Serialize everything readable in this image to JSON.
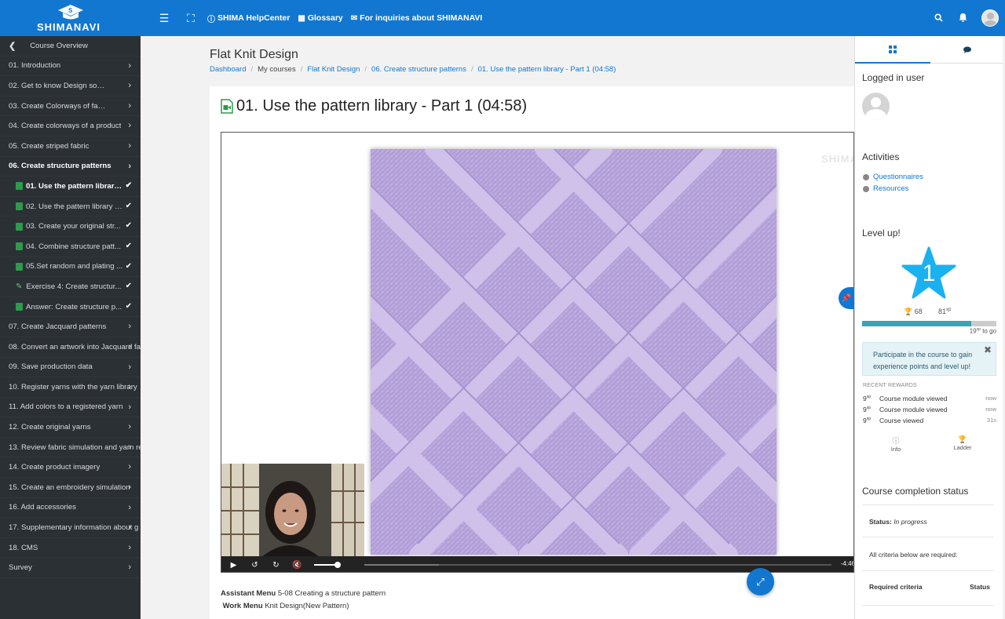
{
  "brand": {
    "name": "SHIMANAVI"
  },
  "topnav": {
    "links": [
      {
        "label": "SHIMA HelpCenter",
        "icon": "help-circle-icon"
      },
      {
        "label": "Glossary",
        "icon": "book-icon"
      },
      {
        "label": "For inquiries about SHIMANAVI",
        "icon": "envelope-icon"
      }
    ]
  },
  "drawer": {
    "back_label": "Course Overview",
    "sections": [
      {
        "label": "01. Introduction"
      },
      {
        "label": "02. Get to know Design software"
      },
      {
        "label": "03. Create Colorways of fabric"
      },
      {
        "label": "04. Create colorways of a product"
      },
      {
        "label": "05. Create striped fabric"
      },
      {
        "label": "06. Create structure patterns"
      }
    ],
    "sub_items": [
      {
        "label": "01. Use the pattern library -...",
        "type": "video"
      },
      {
        "label": "02. Use the pattern library -...",
        "type": "video"
      },
      {
        "label": "03. Create your original str...",
        "type": "video"
      },
      {
        "label": "04. Combine structure patt...",
        "type": "video"
      },
      {
        "label": "05.Set random and plating ...",
        "type": "video"
      },
      {
        "label": "Exercise 4: Create structur...",
        "type": "exercise"
      },
      {
        "label": "Answer: Create structure p...",
        "type": "video"
      }
    ],
    "sections_after": [
      {
        "label": "07. Create Jacquard patterns"
      },
      {
        "label": "08. Convert an artwork into Jacquard fa"
      },
      {
        "label": "09. Save production data"
      },
      {
        "label": "10. Register yarns with the yarn library"
      },
      {
        "label": "11. Add colors to a registered yarn"
      },
      {
        "label": "12. Create original yarns"
      },
      {
        "label": "13. Review fabric simulation and yarn re"
      },
      {
        "label": "14. Create product imagery"
      },
      {
        "label": "15. Create an embroidery simulation"
      },
      {
        "label": "16. Add accessories"
      },
      {
        "label": "17. Supplementary information about g"
      },
      {
        "label": "18. CMS"
      },
      {
        "label": "Survey"
      }
    ]
  },
  "page": {
    "title": "Flat Knit Design",
    "breadcrumb": [
      "Dashboard",
      "My courses",
      "Flat Knit Design",
      "06. Create structure patterns",
      "01. Use the pattern library - Part 1 (04:58)"
    ],
    "activity_title": "01. Use the pattern library - Part 1 (04:58)"
  },
  "player": {
    "watermark": "SHIMA",
    "time": "-4:46",
    "volume": 1.0,
    "progress": 0.0
  },
  "menu_info": {
    "assistant_label": "Assistant Menu",
    "assistant_value": "5-08 Creating a structure pattern",
    "work_label": "Work Menu",
    "work_value": "Knit Design(New Pattern)"
  },
  "right_drawer": {
    "logged_in_title": "Logged in user",
    "activities_title": "Activities",
    "activities": [
      "Questionnaires",
      "Resources"
    ],
    "level_title": "Level up!",
    "level": "1",
    "points": "68",
    "total_xp": "81",
    "xp_unit": "xp",
    "xp_to_go": "19",
    "to_go_label": "to go",
    "xp_fraction": 0.81,
    "info_message": "Participate in the course to gain experience points and level up!",
    "recent_rewards_title": "RECENT REWARDS",
    "rewards": [
      {
        "xp": "9",
        "desc": "Course module viewed",
        "when": "now"
      },
      {
        "xp": "9",
        "desc": "Course module viewed",
        "when": "now"
      },
      {
        "xp": "9",
        "desc": "Course viewed",
        "when": "31s"
      }
    ],
    "info_label": "Info",
    "ladder_label": "Ladder",
    "completion_title": "Course completion status",
    "status_label": "Status:",
    "status_value": "In progress",
    "criteria_note": "All criteria below are required:",
    "col_criteria": "Required criteria",
    "col_status": "Status"
  },
  "colors": {
    "brand_blue": "#1177d1",
    "drawer_bg": "#2b3035",
    "fabric": "#b9a6dd",
    "level_star": "#1ab1f0"
  }
}
